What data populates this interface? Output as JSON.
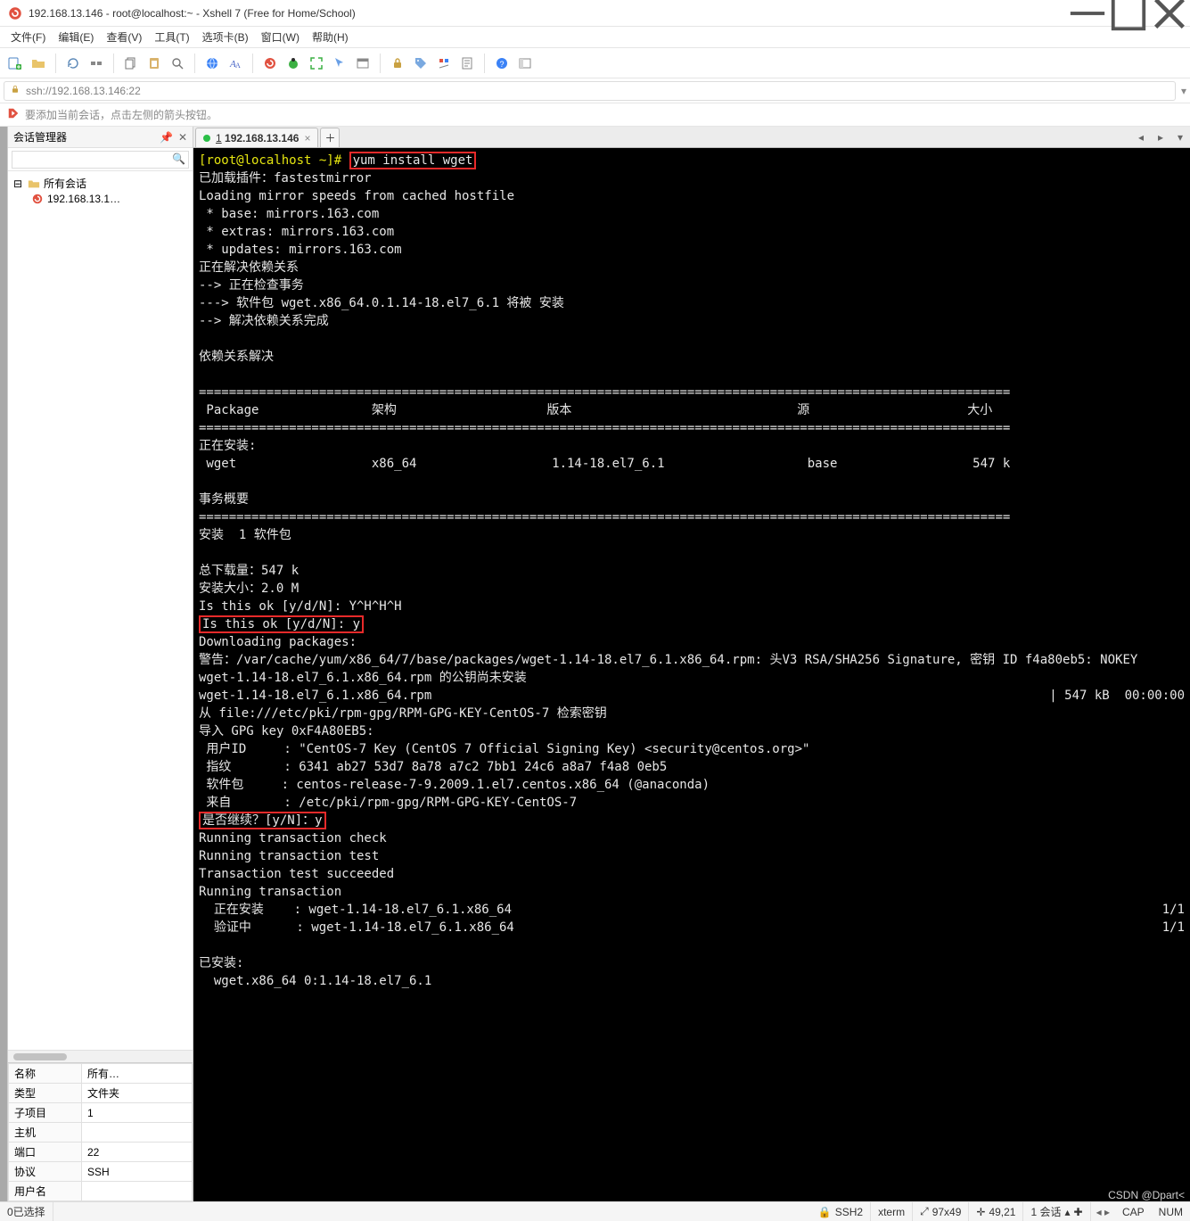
{
  "window": {
    "title": "192.168.13.146 - root@localhost:~ - Xshell 7 (Free for Home/School)"
  },
  "menu": {
    "items": [
      "文件(F)",
      "编辑(E)",
      "查看(V)",
      "工具(T)",
      "选项卡(B)",
      "窗口(W)",
      "帮助(H)"
    ]
  },
  "addr": {
    "text": "ssh://192.168.13.146:22"
  },
  "hint": {
    "text": "要添加当前会话，点击左侧的箭头按钮。"
  },
  "sidebar": {
    "title": "会话管理器",
    "root": "所有会话",
    "session": "192.168.13.1…"
  },
  "props": {
    "rows": [
      {
        "k": "名称",
        "v": "所有…"
      },
      {
        "k": "类型",
        "v": "文件夹"
      },
      {
        "k": "子项目",
        "v": "1"
      },
      {
        "k": "主机",
        "v": ""
      },
      {
        "k": "端口",
        "v": "22"
      },
      {
        "k": "协议",
        "v": "SSH"
      },
      {
        "k": "用户名",
        "v": ""
      }
    ]
  },
  "tabs": {
    "main": {
      "num": "1",
      "host": "192.168.13.146"
    }
  },
  "terminal": {
    "prompt_user": "[root@localhost ~]# ",
    "prompt_cmd": "yum install wget",
    "lines1": "已加载插件：fastestmirror\nLoading mirror speeds from cached hostfile\n * base: mirrors.163.com\n * extras: mirrors.163.com\n * updates: mirrors.163.com\n正在解决依赖关系\n--> 正在检查事务\n---> 软件包 wget.x86_64.0.1.14-18.el7_6.1 将被 安装\n--> 解决依赖关系完成\n\n依赖关系解决\n",
    "rule": "============================================================================================================",
    "header": " Package               架构                    版本                              源                     大小",
    "install_title": "正在安装:",
    "install_row": " wget                  x86_64                  1.14-18.el7_6.1                   base                  547 k",
    "summary_title": "事务概要",
    "summary_line": "安装  1 软件包",
    "preok": "总下载量：547 k\n安装大小：2.0 M\nIs this ok [y/d/N]: Y^H^H^H",
    "ok_prompt": "Is this ok [y/d/N]: y",
    "after_ok": "Downloading packages:\n警告：/var/cache/yum/x86_64/7/base/packages/wget-1.14-18.el7_6.1.x86_64.rpm: 头V3 RSA/SHA256 Signature, 密钥 ID f4a80eb5: NOKEY\nwget-1.14-18.el7_6.1.x86_64.rpm 的公钥尚未安装",
    "dl_left": "wget-1.14-18.el7_6.1.x86_64.rpm",
    "dl_right": "| 547 kB  00:00:00",
    "gpg_block": "从 file:///etc/pki/rpm-gpg/RPM-GPG-KEY-CentOS-7 检索密钥\n导入 GPG key 0xF4A80EB5:\n 用户ID     : \"CentOS-7 Key (CentOS 7 Official Signing Key) <security@centos.org>\"\n 指纹       : 6341 ab27 53d7 8a78 a7c2 7bb1 24c6 a8a7 f4a8 0eb5\n 软件包     : centos-release-7-9.2009.1.el7.centos.x86_64 (@anaconda)\n 来自       : /etc/pki/rpm-gpg/RPM-GPG-KEY-CentOS-7",
    "cont_prompt": "是否继续？[y/N]：y",
    "run_block": "Running transaction check\nRunning transaction test\nTransaction test succeeded\nRunning transaction",
    "step1_left": "  正在安装    : wget-1.14-18.el7_6.1.x86_64",
    "step1_right": "1/1",
    "step2_left": "  验证中      : wget-1.14-18.el7_6.1.x86_64",
    "step2_right": "1/1",
    "installed": "已安装:\n  wget.x86_64 0:1.14-18.el7_6.1"
  },
  "status": {
    "left": "0已选择",
    "ssh": "SSH2",
    "term": "xterm",
    "size": "97x49",
    "cursor": "49,21",
    "sess": "1 会话",
    "cap": "CAP",
    "num": "NUM"
  },
  "icons": {
    "min": "min",
    "max": "max",
    "close": "close"
  },
  "colors": {
    "accent_green": "#2bbf47",
    "accent_red": "#e82a2a",
    "terminal_fg": "#e6e6e6"
  }
}
